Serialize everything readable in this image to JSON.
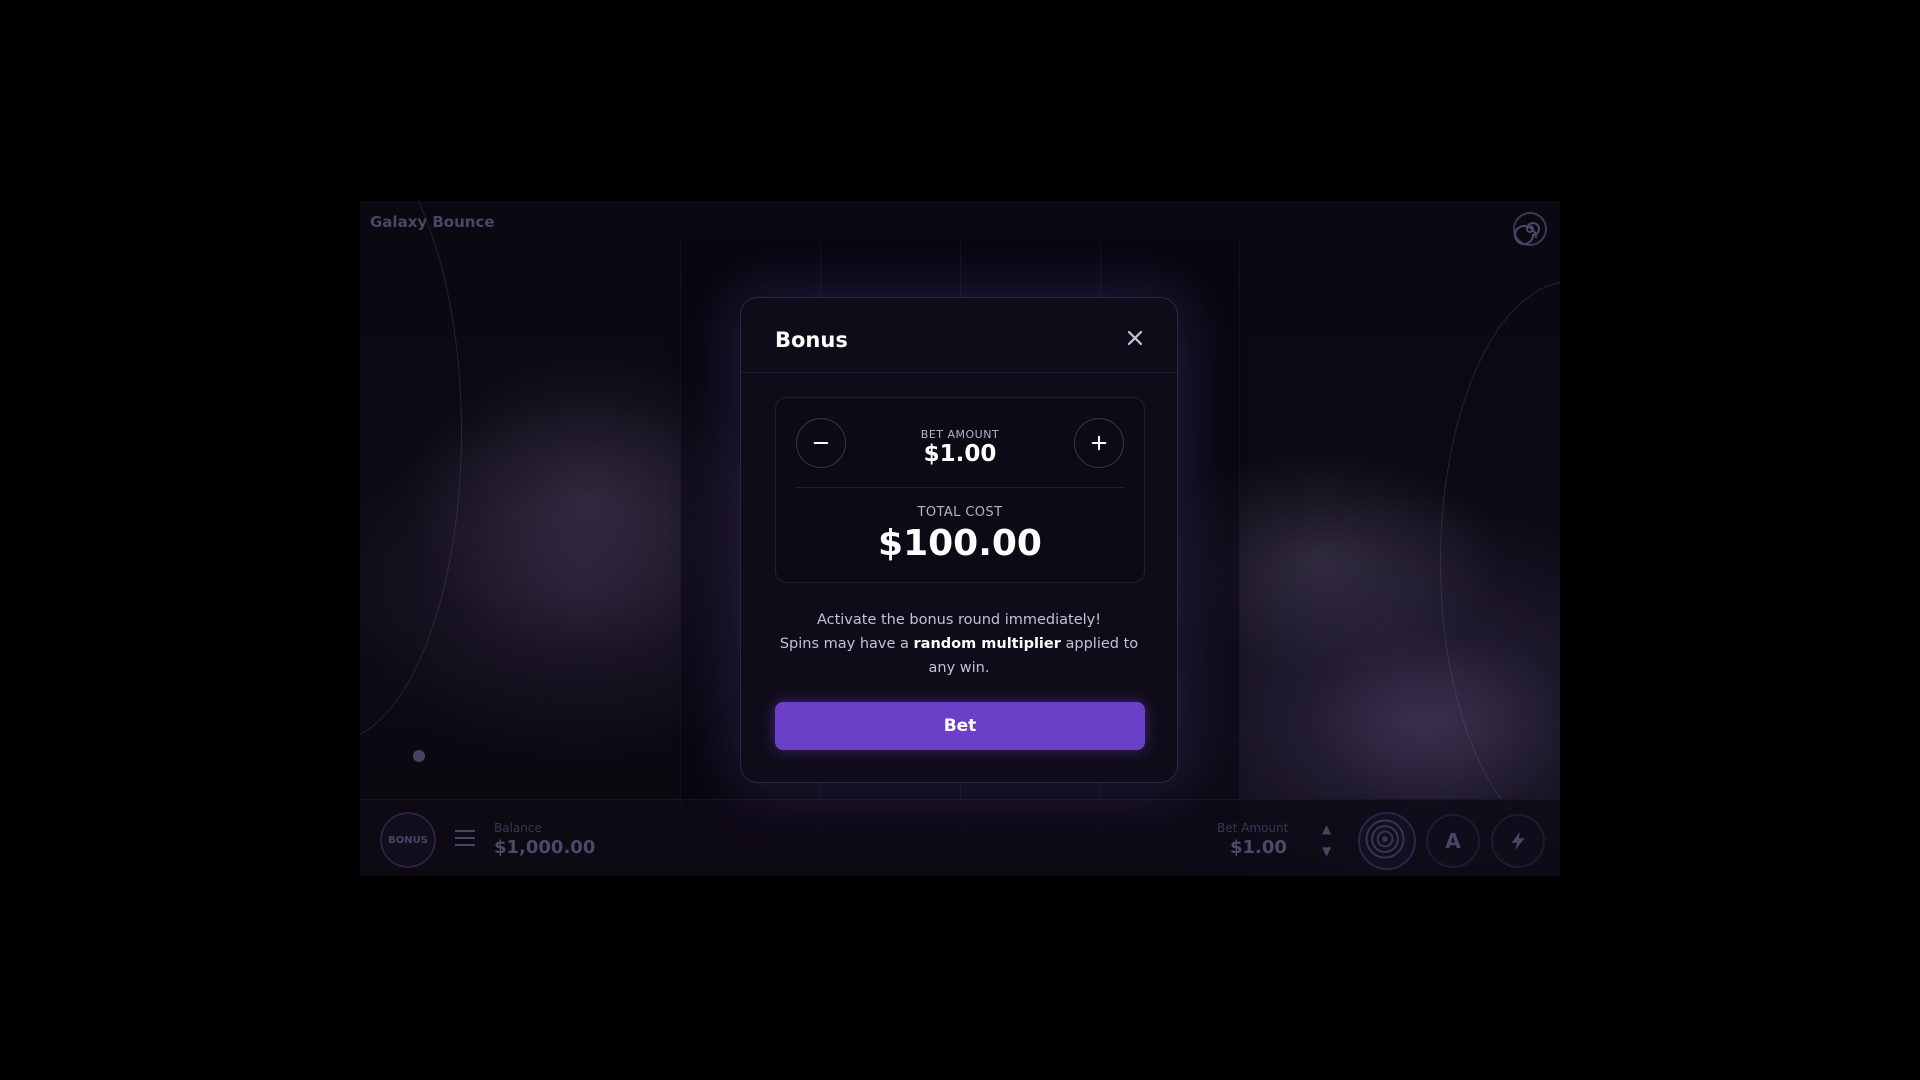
{
  "game": {
    "title": "Galaxy Bounce",
    "balance_label": "Balance",
    "balance_value": "$1,000.00",
    "bet_label": "Bet Amount",
    "bet_value": "$1.00",
    "bonus_button_label": "BONUS",
    "auto_button_label": "A"
  },
  "modal": {
    "title": "Bonus",
    "bet_amount_label": "BET AMOUNT",
    "bet_amount_value": "$1.00",
    "total_cost_label": "TOTAL COST",
    "total_cost_value": "$100.00",
    "description_line1": "Activate the bonus round immediately!",
    "description_prefix": "Spins may have a ",
    "description_highlight": "random multiplier",
    "description_suffix": " applied to any win.",
    "bet_button_label": "Bet"
  },
  "colors": {
    "accent": "#6b3fc8",
    "modal_bg": "#0f0c19",
    "page_bg": "#000000"
  },
  "icons": [
    "close-icon",
    "minus-icon",
    "plus-icon",
    "menu-icon",
    "spiral-icon",
    "lightning-icon",
    "arrow-up-icon",
    "arrow-down-icon"
  ]
}
